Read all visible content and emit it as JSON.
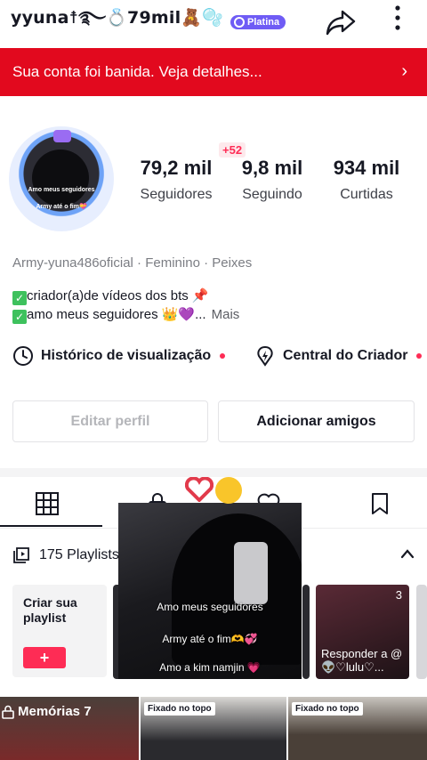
{
  "header": {
    "username": "yyuna",
    "username_suffix": "☨࿐💍79mil🧸🫧",
    "badge": "Platina"
  },
  "banner": {
    "text": "Sua conta foi banida. Veja detalhes..."
  },
  "profile": {
    "avatar_caption_1": "Amo meus seguidores",
    "avatar_caption_2": "Army até o fim💝",
    "new_followers": "+52",
    "stats": [
      {
        "value": "79,2 mil",
        "label": "Seguidores"
      },
      {
        "value": "9,8 mil",
        "label": "Seguindo"
      },
      {
        "value": "934 mil",
        "label": "Curtidas"
      }
    ],
    "meta": "Army-yuna486oficial · Feminino · Peixes",
    "bio_line_1": "criador(a)de vídeos dos bts 📌",
    "bio_line_2": "amo meus seguidores 👑💜...",
    "bio_more": "Mais"
  },
  "links": {
    "history": "Histórico de visualização",
    "creator_center": "Central do Criador"
  },
  "buttons": {
    "edit_profile": "Editar perfil",
    "add_friends": "Adicionar amigos"
  },
  "playlists": {
    "header": "175 Playlists",
    "create_label": "Criar sua playlist",
    "card_right_title": "Responder a @👽♡lulu♡...",
    "card_right_count": "3"
  },
  "popup": {
    "caption_1": "Amo meus seguidores",
    "caption_2": "Army até o fim🫶💞",
    "caption_3": "Amo a kim namjin 💗"
  },
  "grid": {
    "memories": "Memórias 7",
    "pinned_1": "Fixado no topo",
    "pinned_2": "Fixado no topo"
  },
  "colors": {
    "accent": "#fe2c55",
    "banner": "#e2091e",
    "badge": "#6f5cf5",
    "text": "#161823"
  }
}
